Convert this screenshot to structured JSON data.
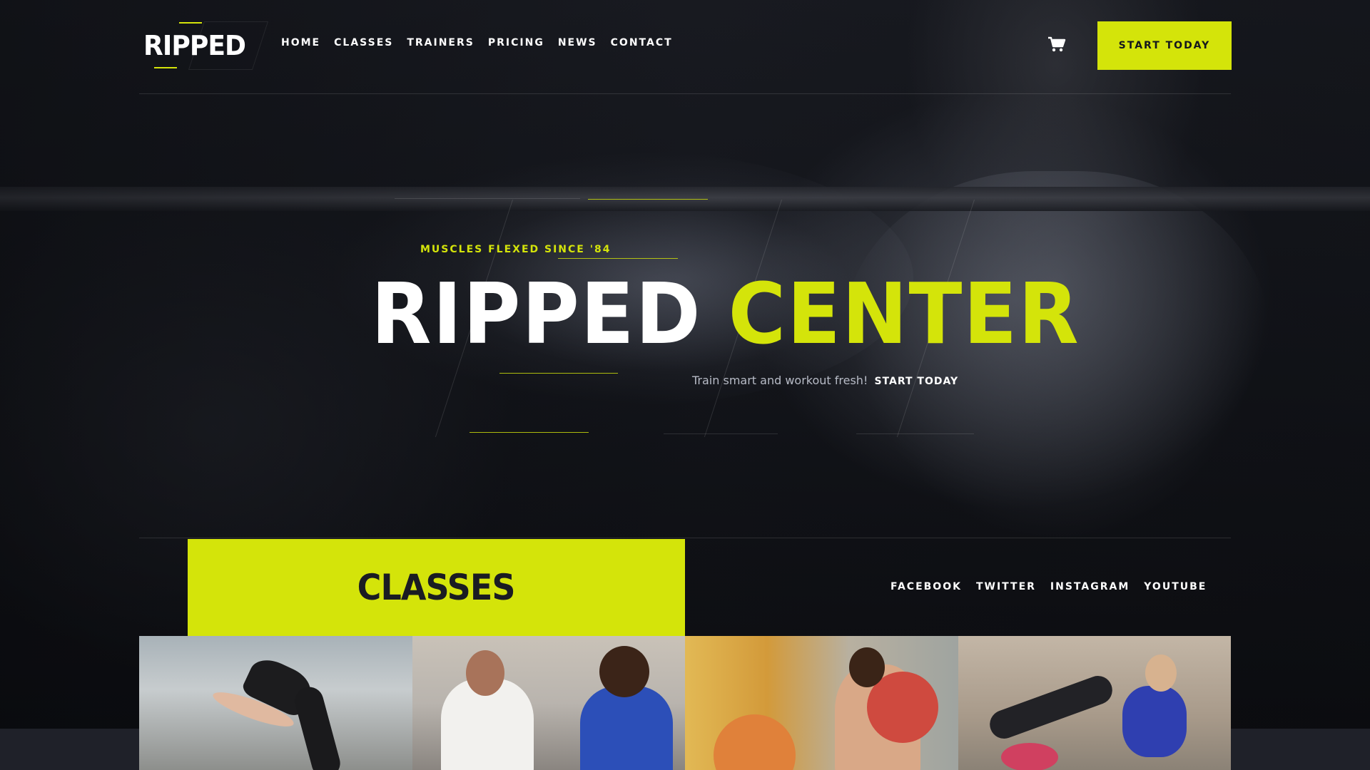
{
  "brand": {
    "logo_text": "RIPPED"
  },
  "nav": {
    "items": [
      {
        "label": "HOME"
      },
      {
        "label": "CLASSES"
      },
      {
        "label": "TRAINERS"
      },
      {
        "label": "PRICING"
      },
      {
        "label": "NEWS"
      },
      {
        "label": "CONTACT"
      }
    ],
    "cart_icon": "cart-icon",
    "cta_label": "START TODAY"
  },
  "hero": {
    "eyebrow": "MUSCLES FLEXED SINCE '84",
    "title_word1": "RIPPED",
    "title_word2": "CENTER",
    "tagline": "Train smart and workout fresh!",
    "tagline_link": "START TODAY"
  },
  "classes": {
    "title": "CLASSES",
    "tiles": [
      {
        "icon": "backbend-photo"
      },
      {
        "icon": "high-five-photo"
      },
      {
        "icon": "medicine-ball-photo"
      },
      {
        "icon": "situp-photo"
      }
    ]
  },
  "social": {
    "items": [
      {
        "label": "FACEBOOK"
      },
      {
        "label": "TWITTER"
      },
      {
        "label": "INSTAGRAM"
      },
      {
        "label": "YOUTUBE"
      }
    ]
  },
  "colors": {
    "accent": "#d4e40a",
    "background": "#0b0c10",
    "text": "#ffffff",
    "strip": "#1f2129"
  }
}
